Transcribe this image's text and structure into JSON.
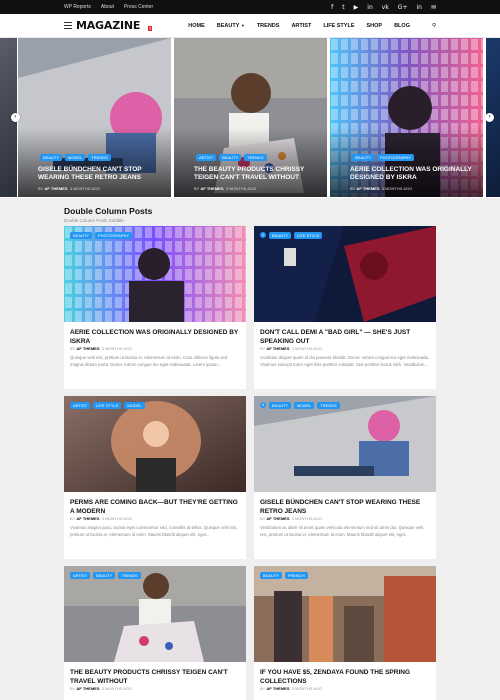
{
  "topbar": {
    "links": [
      "WP Reports",
      "About",
      "Press Center"
    ],
    "social": [
      "f",
      "t",
      "▶",
      "in",
      "vk",
      "G+",
      "in",
      "✉"
    ]
  },
  "header": {
    "logo": "MAGAZINE",
    "logo_badge": "7",
    "nav": [
      "HOME",
      "BEAUTY",
      "TRENDS",
      "ARTIST",
      "LIFE STYLE",
      "SHOP",
      "BLOG"
    ],
    "dropdown_icon": "chevron-down-icon",
    "search_icon": "search-icon"
  },
  "slider": {
    "slides": [
      {
        "cats": [
          "BEAUTY",
          "MODEL",
          "TRENDS"
        ],
        "title": "GISELE BÜNDCHEN CAN'T STOP WEARING THESE RETRO JEANS",
        "by": "BY",
        "author": "AF THEMES",
        "time": "3 MONTHS AGO"
      },
      {
        "cats": [
          "ARTIST",
          "BEAUTY",
          "TRENDS"
        ],
        "title": "THE BEAUTY PRODUCTS CHRISSY TEIGEN CAN'T TRAVEL WITHOUT",
        "by": "BY",
        "author": "AF THEMES",
        "time": "3 MONTHS AGO"
      },
      {
        "cats": [
          "BEAUTY",
          "PHOTOGRAPHY"
        ],
        "title": "AERIE COLLECTION WAS ORIGINALLY DESIGNED BY ISKRA",
        "by": "BY",
        "author": "AF THEMES",
        "time": "3 MONTHS AGO"
      }
    ]
  },
  "section": {
    "title": "Double Column Posts",
    "subtitle": "Double Column Posts Subtitle"
  },
  "posts": [
    {
      "cats": [
        "BEAUTY",
        "PHOTOGRAPHY"
      ],
      "title": "AERIE COLLECTION WAS ORIGINALLY DESIGNED BY ISKRA",
      "by": "BY",
      "author": "AF THEMES",
      "time": "3 MONTHS AGO",
      "excerpt": "Quisque velit nisi, pretium ut lacinia in, elementum id enim. Cras ultricies ligula sed magna dictum porta. Donec rutrum congue leo eget malesuada. Lorem ipsum..."
    },
    {
      "num": "1",
      "cats": [
        "BEAUTY",
        "LIFE STYLE"
      ],
      "title": "DON'T CALL DEMI A \"BAD GIRL\" — SHE'S JUST SPEAKING OUT",
      "by": "BY",
      "author": "AF THEMES",
      "time": "3 MONTHS AGO",
      "excerpt": "Curabitur aliquet quam id dui posuere blandit. Donec rutrum congue leo eget malesuada. Vivamus suscipit tortor eget felis porttitor volutpat. Sed porttitor lectus nibh. Vestibulum..."
    },
    {
      "cats": [
        "ARTIST",
        "LIFE STYLE",
        "MODEL"
      ],
      "title": "PERMS ARE COMING BACK—BUT THEY'RE GETTING A MODERN",
      "by": "BY",
      "author": "AF THEMES",
      "time": "3 MONTHS AGO",
      "excerpt": "Vivamus magna justo, lacinia eget consectetur sed, convallis at tellus. Quisque velit nisi, pretium ut lacinia in, elementum id enim. Mauris blandit aliquet elit, eget..."
    },
    {
      "num": "3",
      "cats": [
        "BEAUTY",
        "MODEL",
        "TRENDS"
      ],
      "title": "GISELE BÜNDCHEN CAN'T STOP WEARING THESE RETRO JEANS",
      "by": "BY",
      "author": "AF THEMES",
      "time": "3 MONTHS AGO",
      "excerpt": "Vestibulum ac diam sit amet quam vehicula elementum sed sit amet dui. Quisque velit nisi, pretium ut lacinia in, elementum id enim. Mauris blandit aliquet elit, eget..."
    },
    {
      "cats": [
        "ARTIST",
        "BEAUTY",
        "TRENDS"
      ],
      "title": "THE BEAUTY PRODUCTS CHRISSY TEIGEN CAN'T TRAVEL WITHOUT",
      "by": "BY",
      "author": "AF THEMES",
      "time": "3 MONTHS AGO",
      "excerpt": ""
    },
    {
      "cats": [
        "BEAUTY",
        "FRENCH"
      ],
      "title": "IF YOU HAVE $5, ZENDAYA FOUND THE SPRING COLLECTIONS",
      "by": "BY",
      "author": "AF THEMES",
      "time": "3 MONTHS AGO",
      "excerpt": ""
    }
  ]
}
